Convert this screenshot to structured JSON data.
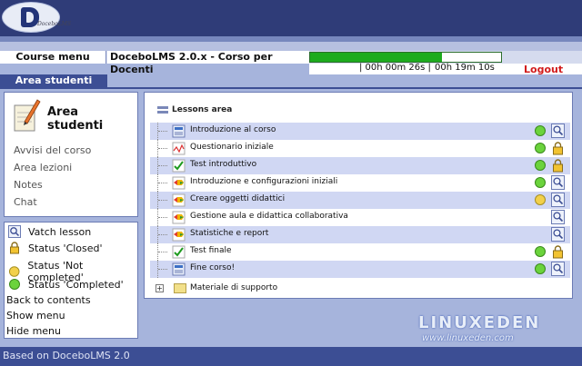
{
  "header": {
    "course_menu": "Course menu",
    "course_title": "DoceboLMS 2.0.x - Corso per Docenti",
    "timer_session": "| 00h 00m 26s |",
    "timer_total": "00h 19m 10s",
    "logout": "Logout",
    "progress": 0.69,
    "logo_text": "DoceboLMS"
  },
  "tab": {
    "label": "Area studenti"
  },
  "left": {
    "title": "Area studenti",
    "nav": [
      "Avvisi del corso",
      "Area lezioni",
      "Notes",
      "Chat"
    ]
  },
  "legend": {
    "items": [
      {
        "label": "Vatch lesson",
        "icon": "magnifier-icon"
      },
      {
        "label": "Status 'Closed'",
        "icon": "lock-icon"
      },
      {
        "label": "Status 'Not completed'",
        "icon": "yellow-dot-icon"
      },
      {
        "label": "Status 'Completed'",
        "icon": "green-dot-icon"
      }
    ],
    "links": [
      "Back to contents",
      "Show menu",
      "Hide menu"
    ]
  },
  "lessons": {
    "title": "Lessons area",
    "rows": [
      {
        "label": "Introduzione al corso",
        "status": "green",
        "action": "magnifier"
      },
      {
        "label": "Questionario iniziale",
        "status": "green",
        "action": "lock"
      },
      {
        "label": "Test introduttivo",
        "status": "green",
        "action": "lock"
      },
      {
        "label": "Introduzione e configurazioni iniziali",
        "status": "green",
        "action": "magnifier"
      },
      {
        "label": "Creare oggetti didattici",
        "status": "yellow",
        "action": "magnifier"
      },
      {
        "label": "Gestione aula e didattica collaborativa",
        "status": "",
        "action": "magnifier"
      },
      {
        "label": "Statistiche e report",
        "status": "",
        "action": "magnifier"
      },
      {
        "label": "Test finale",
        "status": "green",
        "action": "lock"
      },
      {
        "label": "Fine corso!",
        "status": "green",
        "action": "magnifier"
      }
    ],
    "folder": "Materiale di supporto"
  },
  "footer": {
    "text": "Based on DoceboLMS 2.0"
  },
  "watermark": {
    "top": "LINUXEDEN",
    "bottom": "www.linuxeden.com"
  },
  "colors": {
    "header": "#2f3c78",
    "accent": "#3c4e94",
    "progress": "#1dab1d",
    "logout": "#d21b1b"
  }
}
